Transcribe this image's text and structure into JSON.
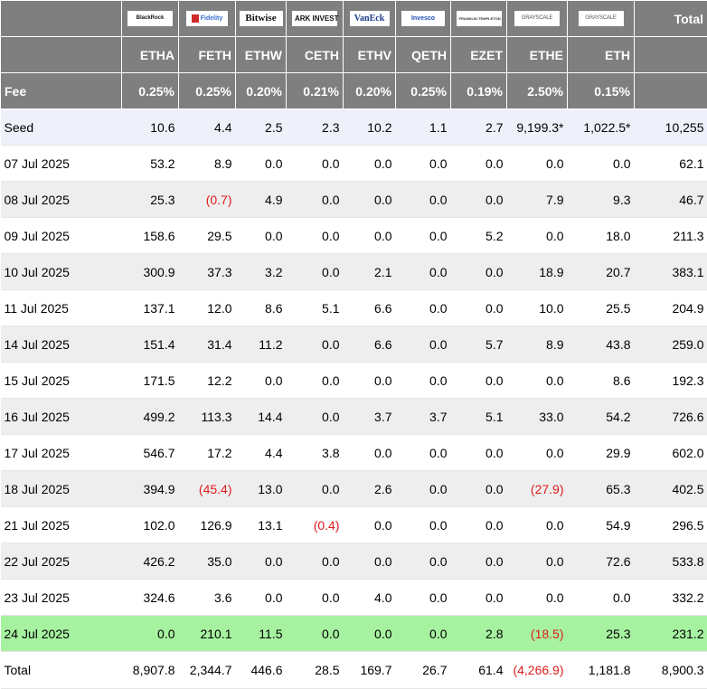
{
  "header": {
    "issuers": [
      {
        "logo_text": "BlackRock",
        "icon": "blackrock-logo"
      },
      {
        "logo_text": "Fidelity",
        "icon": "fidelity-logo"
      },
      {
        "logo_text": "Bitwise",
        "icon": "bitwise-logo"
      },
      {
        "logo_text": "ARK INVEST",
        "icon": "ark-invest-logo"
      },
      {
        "logo_text": "VanEck",
        "icon": "vaneck-logo"
      },
      {
        "logo_text": "Invesco",
        "icon": "invesco-logo"
      },
      {
        "logo_text": "FRANKLIN TEMPLETON",
        "icon": "franklin-templeton-logo"
      },
      {
        "logo_text": "GRAYSCALE",
        "icon": "grayscale-logo"
      },
      {
        "logo_text": "GRAYSCALE",
        "icon": "grayscale-logo"
      }
    ],
    "total_label": "Total",
    "tickers": [
      "ETHA",
      "FETH",
      "ETHW",
      "CETH",
      "ETHV",
      "QETH",
      "EZET",
      "ETHE",
      "ETH"
    ],
    "fee_label": "Fee",
    "fees": [
      "0.25%",
      "0.25%",
      "0.20%",
      "0.21%",
      "0.20%",
      "0.25%",
      "0.19%",
      "2.50%",
      "0.15%"
    ]
  },
  "rows": [
    {
      "date": "Seed",
      "values": [
        "10.6",
        "4.4",
        "2.5",
        "2.3",
        "10.2",
        "1.1",
        "2.7",
        "9,199.3*",
        "1,022.5*"
      ],
      "total": "10,255"
    },
    {
      "date": "07 Jul 2025",
      "values": [
        "53.2",
        "8.9",
        "0.0",
        "0.0",
        "0.0",
        "0.0",
        "0.0",
        "0.0",
        "0.0"
      ],
      "total": "62.1"
    },
    {
      "date": "08 Jul 2025",
      "values": [
        "25.3",
        "(0.7)",
        "4.9",
        "0.0",
        "0.0",
        "0.0",
        "0.0",
        "7.9",
        "9.3"
      ],
      "total": "46.7"
    },
    {
      "date": "09 Jul 2025",
      "values": [
        "158.6",
        "29.5",
        "0.0",
        "0.0",
        "0.0",
        "0.0",
        "5.2",
        "0.0",
        "18.0"
      ],
      "total": "211.3"
    },
    {
      "date": "10 Jul 2025",
      "values": [
        "300.9",
        "37.3",
        "3.2",
        "0.0",
        "2.1",
        "0.0",
        "0.0",
        "18.9",
        "20.7"
      ],
      "total": "383.1"
    },
    {
      "date": "11 Jul 2025",
      "values": [
        "137.1",
        "12.0",
        "8.6",
        "5.1",
        "6.6",
        "0.0",
        "0.0",
        "10.0",
        "25.5"
      ],
      "total": "204.9"
    },
    {
      "date": "14 Jul 2025",
      "values": [
        "151.4",
        "31.4",
        "11.2",
        "0.0",
        "6.6",
        "0.0",
        "5.7",
        "8.9",
        "43.8"
      ],
      "total": "259.0"
    },
    {
      "date": "15 Jul 2025",
      "values": [
        "171.5",
        "12.2",
        "0.0",
        "0.0",
        "0.0",
        "0.0",
        "0.0",
        "0.0",
        "8.6"
      ],
      "total": "192.3"
    },
    {
      "date": "16 Jul 2025",
      "values": [
        "499.2",
        "113.3",
        "14.4",
        "0.0",
        "3.7",
        "3.7",
        "5.1",
        "33.0",
        "54.2"
      ],
      "total": "726.6"
    },
    {
      "date": "17 Jul 2025",
      "values": [
        "546.7",
        "17.2",
        "4.4",
        "3.8",
        "0.0",
        "0.0",
        "0.0",
        "0.0",
        "29.9"
      ],
      "total": "602.0"
    },
    {
      "date": "18 Jul 2025",
      "values": [
        "394.9",
        "(45.4)",
        "13.0",
        "0.0",
        "2.6",
        "0.0",
        "0.0",
        "(27.9)",
        "65.3"
      ],
      "total": "402.5"
    },
    {
      "date": "21 Jul 2025",
      "values": [
        "102.0",
        "126.9",
        "13.1",
        "(0.4)",
        "0.0",
        "0.0",
        "0.0",
        "0.0",
        "54.9"
      ],
      "total": "296.5"
    },
    {
      "date": "22 Jul 2025",
      "values": [
        "426.2",
        "35.0",
        "0.0",
        "0.0",
        "0.0",
        "0.0",
        "0.0",
        "0.0",
        "72.6"
      ],
      "total": "533.8"
    },
    {
      "date": "23 Jul 2025",
      "values": [
        "324.6",
        "3.6",
        "0.0",
        "0.0",
        "4.0",
        "0.0",
        "0.0",
        "0.0",
        "0.0"
      ],
      "total": "332.2"
    },
    {
      "date": "24 Jul 2025",
      "values": [
        "0.0",
        "210.1",
        "11.5",
        "0.0",
        "0.0",
        "0.0",
        "2.8",
        "(18.5)",
        "25.3"
      ],
      "total": "231.2"
    },
    {
      "date": "Total",
      "values": [
        "8,907.8",
        "2,344.7",
        "446.6",
        "28.5",
        "169.7",
        "26.7",
        "61.4",
        "(4,266.9)",
        "1,181.8"
      ],
      "total": "8,900.3"
    }
  ],
  "colors": {
    "header_bg": "#7f7f7f",
    "seed_row_bg": "#eef1f9",
    "stripe_bg": "#eeeeee",
    "highlight_row_bg": "#a6f2a0",
    "negative_text": "#e01b1b"
  }
}
